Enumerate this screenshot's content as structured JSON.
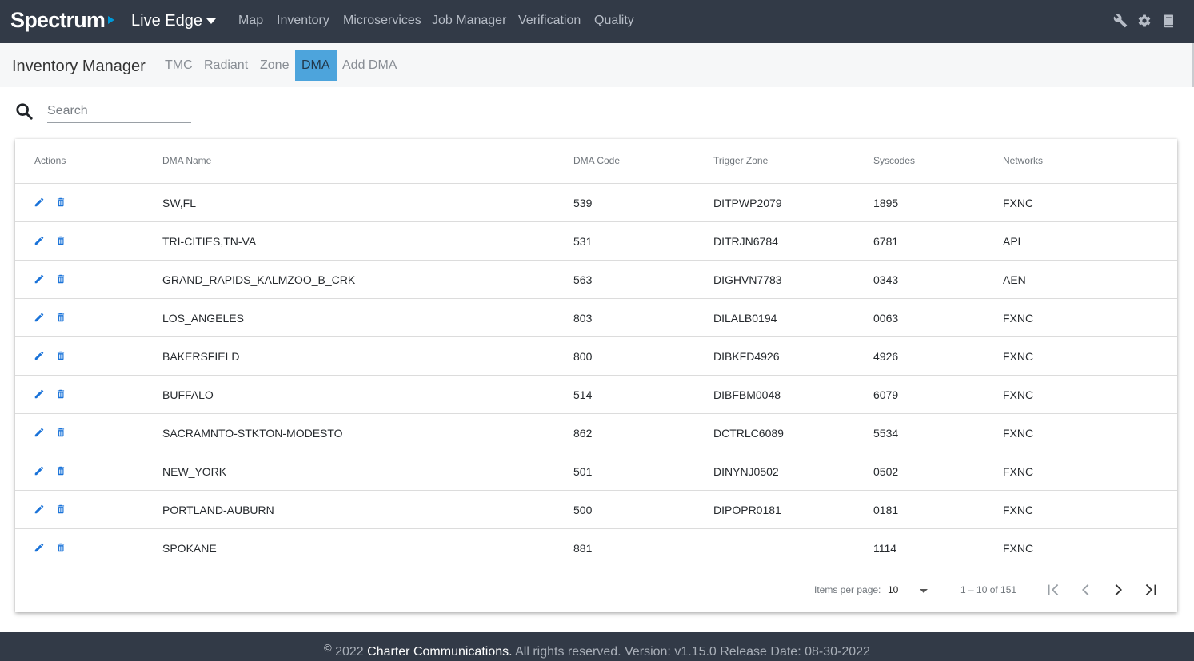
{
  "header": {
    "logo": "Spectrum",
    "app_title": "Live Edge",
    "nav": [
      "Map",
      "Inventory",
      "Microservices",
      "Job Manager",
      "Verification",
      "Quality"
    ],
    "icons": [
      "wrench-icon",
      "gear-icon",
      "book-icon"
    ]
  },
  "subheader": {
    "title": "Inventory Manager",
    "tabs": [
      {
        "label": "TMC",
        "active": false
      },
      {
        "label": "Radiant",
        "active": false
      },
      {
        "label": "Zone",
        "active": false
      },
      {
        "label": "DMA",
        "active": true
      },
      {
        "label": "Add DMA",
        "active": false
      }
    ]
  },
  "search": {
    "placeholder": "Search",
    "value": ""
  },
  "table": {
    "columns": [
      "Actions",
      "DMA Name",
      "DMA Code",
      "Trigger Zone",
      "Syscodes",
      "Networks"
    ],
    "rows": [
      {
        "name": "SW,FL",
        "code": "539",
        "trigger": "DITPWP2079",
        "syscode": "1895",
        "network": "FXNC"
      },
      {
        "name": "TRI-CITIES,TN-VA",
        "code": "531",
        "trigger": "DITRJN6784",
        "syscode": "6781",
        "network": "APL"
      },
      {
        "name": "GRAND_RAPIDS_KALMZOO_B_CRK",
        "code": "563",
        "trigger": "DIGHVN7783",
        "syscode": "0343",
        "network": "AEN"
      },
      {
        "name": "LOS_ANGELES",
        "code": "803",
        "trigger": "DILALB0194",
        "syscode": "0063",
        "network": "FXNC"
      },
      {
        "name": "BAKERSFIELD",
        "code": "800",
        "trigger": "DIBKFD4926",
        "syscode": "4926",
        "network": "FXNC"
      },
      {
        "name": "BUFFALO",
        "code": "514",
        "trigger": "DIBFBM0048",
        "syscode": "6079",
        "network": "FXNC"
      },
      {
        "name": "SACRAMNTO-STKTON-MODESTO",
        "code": "862",
        "trigger": "DCTRLC6089",
        "syscode": "5534",
        "network": "FXNC"
      },
      {
        "name": "NEW_YORK",
        "code": "501",
        "trigger": "DINYNJ0502",
        "syscode": "0502",
        "network": "FXNC"
      },
      {
        "name": "PORTLAND-AUBURN",
        "code": "500",
        "trigger": "DIPOPR0181",
        "syscode": "0181",
        "network": "FXNC"
      },
      {
        "name": "SPOKANE",
        "code": "881",
        "trigger": "",
        "syscode": "1114",
        "network": "FXNC"
      }
    ]
  },
  "paginator": {
    "items_per_page_label": "Items per page:",
    "items_per_page": "10",
    "range": "1 – 10 of 151"
  },
  "footer": {
    "copyright": "©",
    "year": "2022",
    "company": "Charter Communications.",
    "rest": "All rights reserved. Version: v1.15.0 Release Date: 08-30-2022"
  },
  "colors": {
    "topbar": "#323a47",
    "active_tab": "#4da4dc",
    "action_icon": "#1a73d9"
  }
}
